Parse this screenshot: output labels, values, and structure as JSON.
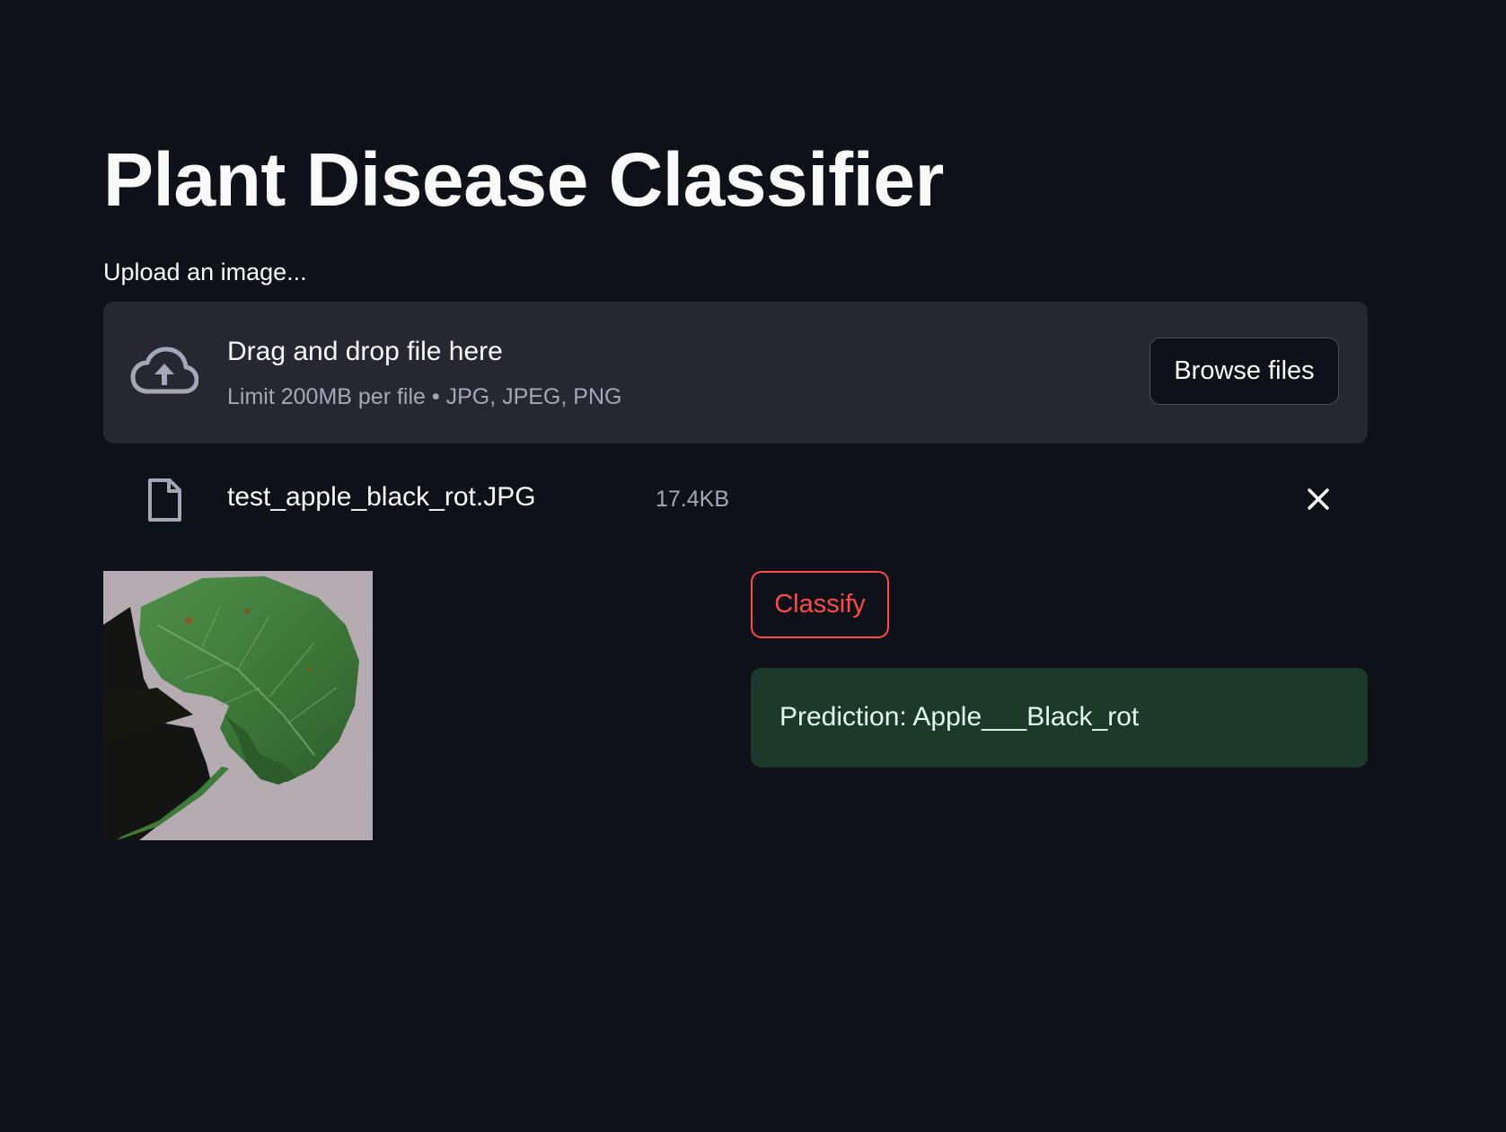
{
  "page": {
    "title": "Plant Disease Classifier"
  },
  "uploader": {
    "label": "Upload an image...",
    "drop_title": "Drag and drop file here",
    "limit_text": "Limit 200MB per file • JPG, JPEG, PNG",
    "browse_label": "Browse files",
    "icon": "cloud-upload-icon"
  },
  "uploaded_file": {
    "name": "test_apple_black_rot.JPG",
    "size": "17.4KB",
    "icon": "file-icon",
    "remove_icon": "close-icon"
  },
  "image_preview": {
    "description_icon": "leaf-image"
  },
  "actions": {
    "classify_label": "Classify"
  },
  "result": {
    "prediction": "Prediction: Apple___Black_rot"
  },
  "colors": {
    "background": "#0e1117",
    "dropzone": "#262730",
    "accent": "#ff4b4b",
    "success_bg": "#1b3a2a",
    "success_text": "#dffde9"
  }
}
